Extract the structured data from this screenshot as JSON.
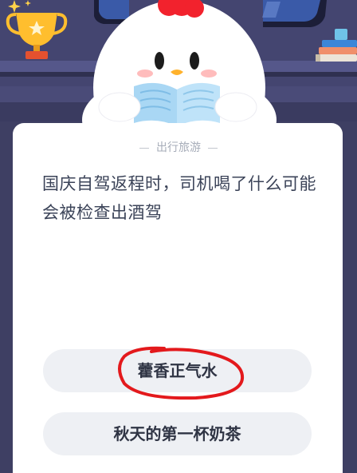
{
  "quiz": {
    "category": "出行旅游",
    "question": "国庆自驾返程时，司机喝了什么可能会被检查出酒驾",
    "options": [
      {
        "label": "藿香正气水"
      },
      {
        "label": "秋天的第一杯奶茶"
      }
    ]
  },
  "decor": {
    "mascot": "chick-mascot-reading",
    "trophy_icon": "trophy-icon",
    "books_icon": "books-icon",
    "sparkle_icon": "sparkle-icon",
    "annotation": "red-hand-drawn-circle"
  },
  "colors": {
    "background": "#3f4064",
    "card": "#ffffff",
    "option_background": "#eef0f4",
    "annotation": "#e3191c",
    "mascot_comb": "#f2222d",
    "book": "#a9d7f4"
  }
}
